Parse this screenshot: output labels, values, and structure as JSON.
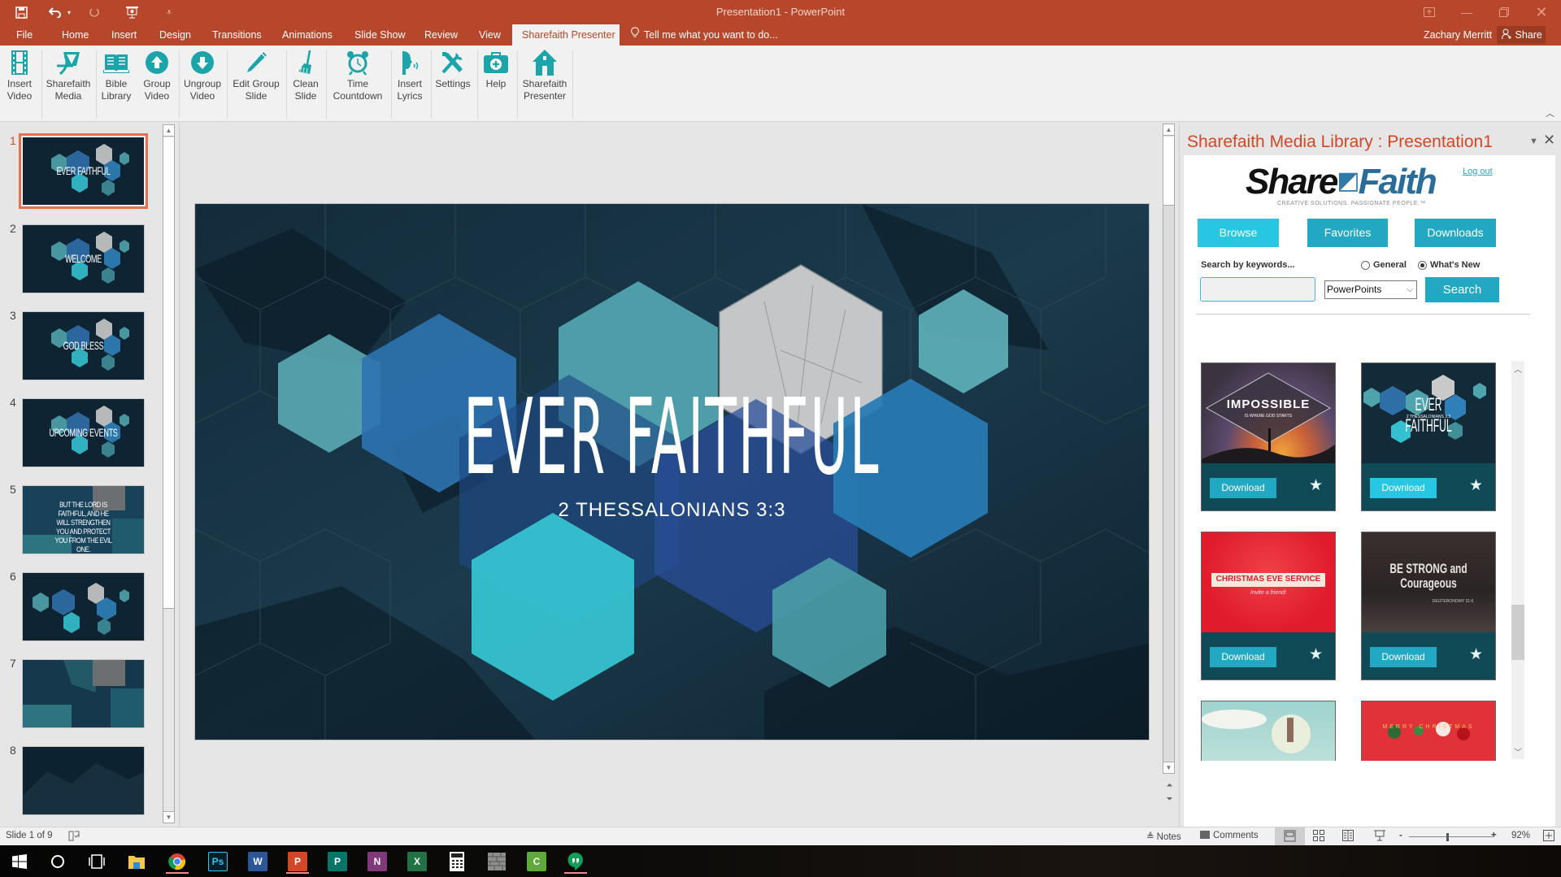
{
  "window": {
    "title": "Presentation1 - PowerPoint",
    "quick_access": [
      {
        "icon": "save-icon"
      },
      {
        "icon": "undo-icon"
      },
      {
        "icon": "redo-icon"
      },
      {
        "icon": "start-from-beginning-icon"
      },
      {
        "icon": "customize-qat-icon"
      }
    ],
    "controls": [
      "ribbon-display-options",
      "minimize",
      "restore",
      "close"
    ]
  },
  "tabs": [
    {
      "label": "File"
    },
    {
      "label": "Home"
    },
    {
      "label": "Insert"
    },
    {
      "label": "Design"
    },
    {
      "label": "Transitions"
    },
    {
      "label": "Animations"
    },
    {
      "label": "Slide Show"
    },
    {
      "label": "Review"
    },
    {
      "label": "View"
    },
    {
      "label": "Sharefaith Presenter",
      "active": true
    }
  ],
  "tell_me": "Tell me what you want to do...",
  "user": {
    "name": "Zachary Merritt",
    "share_label": "Share"
  },
  "ribbon": {
    "accent": "#1ba5ab",
    "buttons": [
      {
        "label1": "Insert",
        "label2": "Video",
        "icon": "film-strip-icon"
      },
      {
        "label1": "Sharefaith",
        "label2": "Media",
        "icon": "sharefaith-logo-icon"
      },
      {
        "label1": "Bible",
        "label2": "Library",
        "icon": "open-book-icon"
      },
      {
        "label1": "Group",
        "label2": "Video",
        "icon": "arrow-up-circle-icon"
      },
      {
        "label1": "Ungroup",
        "label2": "Video",
        "icon": "arrow-down-circle-icon"
      },
      {
        "label1": "Edit Group",
        "label2": "Slide",
        "icon": "pencil-icon"
      },
      {
        "label1": "Clean",
        "label2": "Slide",
        "icon": "broom-icon"
      },
      {
        "label1": "Time",
        "label2": "Countdown",
        "icon": "alarm-clock-icon"
      },
      {
        "label1": "Insert",
        "label2": "Lyrics",
        "icon": "singing-head-icon"
      },
      {
        "label1": "Settings",
        "label2": "",
        "icon": "tools-icon"
      },
      {
        "label1": "Help",
        "label2": "",
        "icon": "first-aid-kit-icon"
      },
      {
        "label1": "Sharefaith",
        "label2": "Presenter",
        "icon": "house-icon"
      }
    ]
  },
  "thumbnails": [
    {
      "num": "1",
      "title": "EVER FAITHFUL",
      "active": true
    },
    {
      "num": "2",
      "title": "WELCOME"
    },
    {
      "num": "3",
      "title": "GOD BLESS"
    },
    {
      "num": "4",
      "title": "UPCOMING EVENTS"
    },
    {
      "num": "5",
      "title": "BUT THE LORD IS FAITHFUL, AND HE WILL STRENGTHEN YOU AND PROTECT YOU FROM THE EVIL ONE."
    },
    {
      "num": "6",
      "title": ""
    },
    {
      "num": "7",
      "title": ""
    },
    {
      "num": "8",
      "title": ""
    }
  ],
  "slide": {
    "title": "EVER FAITHFUL",
    "subtitle": "2 THESSALONIANS 3:3"
  },
  "task_pane": {
    "title": "Sharefaith Media Library : Presentation1",
    "logo_main": "Share",
    "logo_accent": "Faith",
    "tagline": "CREATIVE SOLUTIONS. PASSIONATE PEOPLE.™",
    "logout": "Log out",
    "nav": [
      {
        "label": "Browse",
        "active": true
      },
      {
        "label": "Favorites"
      },
      {
        "label": "Downloads"
      }
    ],
    "search_label": "Search by keywords...",
    "search_value": "",
    "radios": [
      {
        "label": "General",
        "checked": false
      },
      {
        "label": "What's New",
        "checked": true
      }
    ],
    "type_selected": "PowerPoints",
    "search_button": "Search",
    "download_label": "Download",
    "results": [
      {
        "title": "IMPOSSIBLE",
        "subtitle": "IS WHERE GOD STARTS"
      },
      {
        "title": "EVER FAITHFUL",
        "subtitle": "2 THESSALONIANS 3:3"
      },
      {
        "title": "CHRISTMAS EVE SERVICE",
        "subtitle": "Invite a friend!"
      },
      {
        "title": "BE STRONG and Courageous",
        "subtitle": "DEUTERONOMY 31:6"
      },
      {
        "title": "",
        "subtitle": ""
      },
      {
        "title": "MERRY CHRISTMAS",
        "subtitle": ""
      }
    ]
  },
  "status": {
    "slide_info": "Slide 1 of 9",
    "notes": "Notes",
    "comments": "Comments",
    "zoom": "92%",
    "zoom_value_percent": 92
  },
  "taskbar": {
    "apps": [
      {
        "name": "start",
        "icon": "windows-icon"
      },
      {
        "name": "cortana",
        "icon": "search-circle-icon"
      },
      {
        "name": "task-view",
        "icon": "task-view-icon"
      },
      {
        "name": "file-explorer",
        "icon": "folder-icon"
      },
      {
        "name": "chrome",
        "icon": "chrome-icon",
        "running": true
      },
      {
        "name": "photoshop",
        "icon": "photoshop-icon",
        "label": "Ps"
      },
      {
        "name": "word",
        "icon": "word-icon",
        "label": "W"
      },
      {
        "name": "powerpoint",
        "icon": "powerpoint-icon",
        "label": "P",
        "running": true
      },
      {
        "name": "publisher",
        "icon": "publisher-icon",
        "label": "P"
      },
      {
        "name": "onenote",
        "icon": "onenote-icon",
        "label": "N"
      },
      {
        "name": "excel",
        "icon": "excel-icon",
        "label": "X"
      },
      {
        "name": "calculator",
        "icon": "calculator-icon"
      },
      {
        "name": "app",
        "icon": "brick-wall-icon"
      },
      {
        "name": "camtasia",
        "icon": "camtasia-icon",
        "label": "C"
      },
      {
        "name": "hangouts",
        "icon": "hangouts-icon",
        "running": true
      }
    ]
  }
}
